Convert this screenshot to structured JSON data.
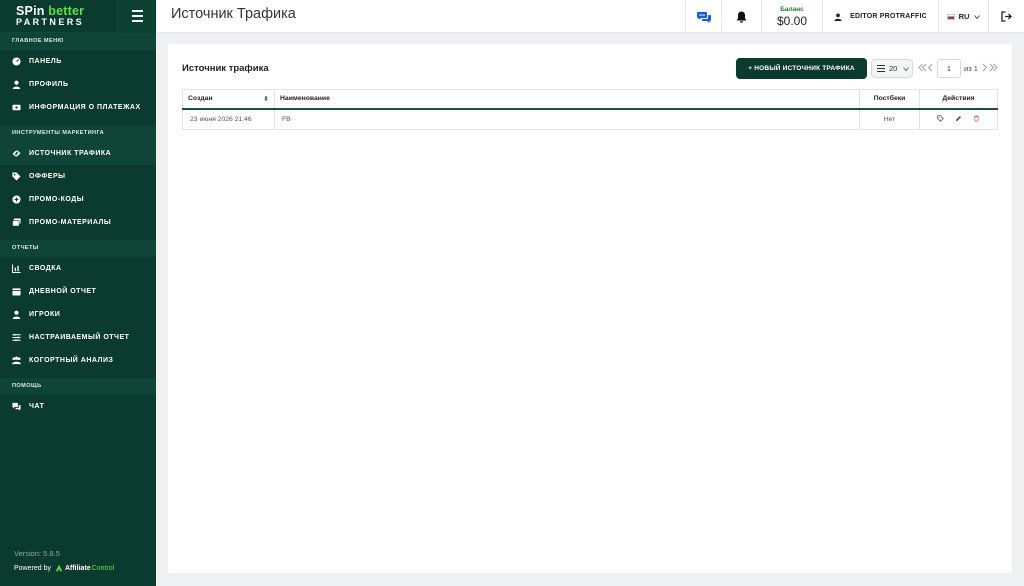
{
  "brand": {
    "line1_a": "SPin",
    "line1_b": "better",
    "line2": "PARTNERS"
  },
  "sidebar": {
    "sections": [
      {
        "title": "ГЛАВНОЕ МЕНЮ",
        "items": [
          {
            "label": "ПАНЕЛЬ",
            "icon": "dashboard-icon"
          },
          {
            "label": "ПРОФИЛЬ",
            "icon": "user-icon"
          },
          {
            "label": "ИНФОРМАЦИЯ О ПЛАТЕЖАХ",
            "icon": "money-icon"
          }
        ]
      },
      {
        "title": "ИНСТРУМЕНТЫ МАРКЕТИНГА",
        "items": [
          {
            "label": "ИСТОЧНИК ТРАФИКА",
            "icon": "link-icon",
            "active": true
          },
          {
            "label": "ОФФЕРЫ",
            "icon": "tag-icon"
          },
          {
            "label": "ПРОМО-КОДЫ",
            "icon": "plus-circle-icon"
          },
          {
            "label": "ПРОМО-МАТЕРИАЛЫ",
            "icon": "images-icon"
          }
        ]
      },
      {
        "title": "ОТЧЕТЫ",
        "items": [
          {
            "label": "СВОДКА",
            "icon": "chart-icon"
          },
          {
            "label": "ДНЕВНОЙ ОТЧЕТ",
            "icon": "calendar-icon"
          },
          {
            "label": "ИГРОКИ",
            "icon": "player-icon"
          },
          {
            "label": "НАСТРАИВАЕМЫЙ ОТЧЕТ",
            "icon": "sliders-icon"
          },
          {
            "label": "КОГОРТНЫЙ АНАЛИЗ",
            "icon": "users-icon"
          }
        ]
      },
      {
        "title": "ПОМОЩЬ",
        "items": [
          {
            "label": "ЧАТ",
            "icon": "chat-icon"
          }
        ]
      }
    ],
    "version": "Version: 5.8.5",
    "powered_by": "Powered by",
    "powered_brand_a": "Affiliate",
    "powered_brand_b": "Control"
  },
  "header": {
    "title": "Источник Трафика",
    "balance_label": "Баланс",
    "balance_value": "$0.00",
    "user": "EDITOR PROTRAFFIC",
    "language": "RU"
  },
  "main": {
    "card_title": "Источник трафика",
    "new_button": "+ НОВЫЙ ИСТОЧНИК ТРАФИКА",
    "per_page": "20",
    "current_page": "1",
    "page_of": "из 1",
    "columns": [
      "Создан",
      "Наименование",
      "Постбеки",
      "Действия"
    ],
    "rows": [
      {
        "created": "23 июня 2026 21:46",
        "name": "FB",
        "postbacks": "Нет"
      }
    ]
  },
  "colors": {
    "sidebar": "#0b3b2e",
    "accent_green": "#5ee04a",
    "delete": "#e05555"
  }
}
